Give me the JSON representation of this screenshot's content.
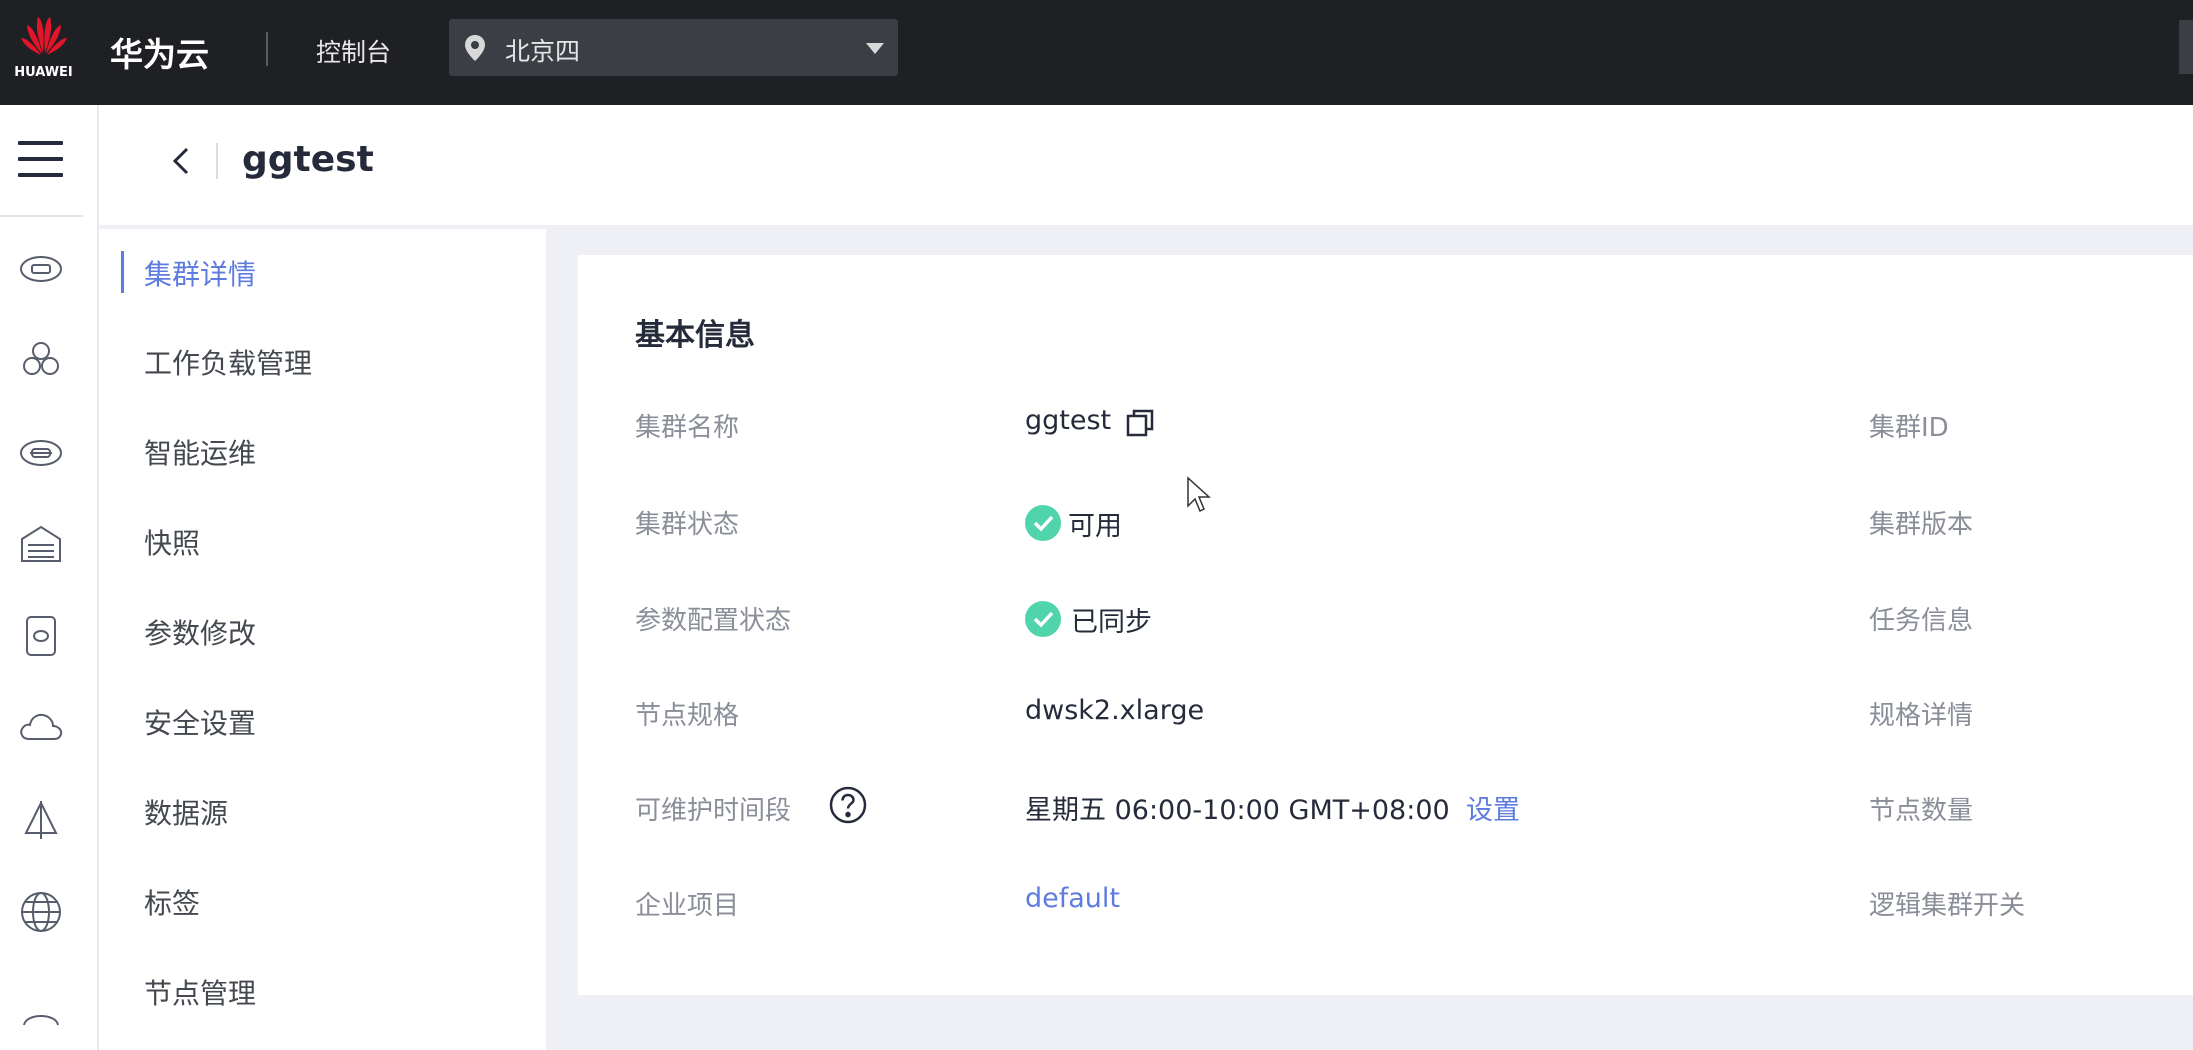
{
  "topbar": {
    "logo_text": "HUAWEI",
    "brand": "华为云",
    "console": "控制台",
    "region": "北京四"
  },
  "rail": {
    "icons": [
      "cloud-server-icon",
      "cluster-icon",
      "network-icon",
      "storage-icon",
      "database-icon",
      "cloud-icon",
      "tool-icon",
      "globe-icon"
    ]
  },
  "header": {
    "title": "ggtest"
  },
  "subnav": {
    "items": [
      "集群详情",
      "工作负载管理",
      "智能运维",
      "快照",
      "参数修改",
      "安全设置",
      "数据源",
      "标签",
      "节点管理"
    ],
    "active_index": 0
  },
  "basic_info": {
    "title": "基本信息",
    "left": {
      "cluster_name_label": "集群名称",
      "cluster_name": "ggtest",
      "cluster_status_label": "集群状态",
      "cluster_status": "可用",
      "param_status_label": "参数配置状态",
      "param_status": "已同步",
      "node_spec_label": "节点规格",
      "node_spec": "dwsk2.xlarge",
      "maintenance_label": "可维护时间段",
      "maintenance_value": "星期五 06:00-10:00 GMT+08:00",
      "maintenance_link": "设置",
      "project_label": "企业项目",
      "project": "default"
    },
    "right": {
      "cluster_id_label": "集群ID",
      "cluster_version_label": "集群版本",
      "task_info_label": "任务信息",
      "spec_detail_label": "规格详情",
      "node_count_label": "节点数量",
      "logical_cluster_label": "逻辑集群开关"
    }
  },
  "colors": {
    "topbar_bg": "#1f2024",
    "accent": "#5e7ce0",
    "success": "#50d4ab",
    "logo_red": "#e3152a"
  }
}
